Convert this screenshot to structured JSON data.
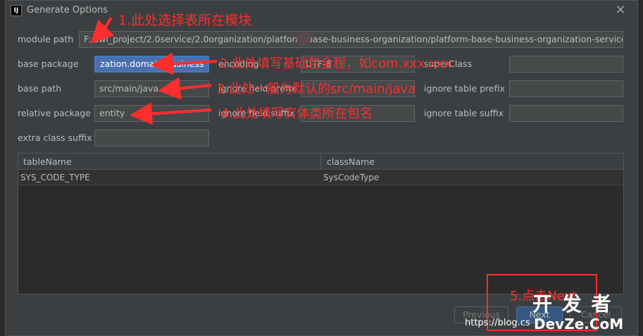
{
  "window": {
    "title": "Generate Options",
    "app_icon_text": "IJ"
  },
  "form": {
    "module_path": {
      "label": "module path",
      "value": "F:/swl_project/2.0service/2.0organization/platform-base-business-organization/platform-base-business-organization-service"
    },
    "base_package": {
      "label": "base package",
      "value": "zation.domain.business"
    },
    "encoding": {
      "label": "encoding",
      "value": "UTF-8"
    },
    "super_class": {
      "label": "superClass",
      "value": ""
    },
    "base_path": {
      "label": "base path",
      "value": "src/main/java"
    },
    "ignore_field_prefix": {
      "label": "ignore field prefix",
      "value": ""
    },
    "ignore_table_prefix": {
      "label": "ignore table prefix",
      "value": ""
    },
    "relative_package": {
      "label": "relative package",
      "value": "entity"
    },
    "ignore_field_suffix": {
      "label": "ignore field suffix",
      "value": ""
    },
    "ignore_table_suffix": {
      "label": "ignore table suffix",
      "value": ""
    },
    "extra_class_suffix": {
      "label": "extra class suffix",
      "value": ""
    }
  },
  "table": {
    "columns": [
      "tableName",
      "className"
    ],
    "rows": [
      [
        "SYS_CODE_TYPE",
        "SysCodeType"
      ]
    ]
  },
  "buttons": {
    "previous": "Previous",
    "next": "Next",
    "cancel": "Cancel"
  },
  "annotations": {
    "a1": "1.此处选择表所在模块",
    "a2": "2.此处填写基础包全程，如com.xxx.xxx",
    "a3": "3.此处一般为默认的src/main/java",
    "a4": "4.此处填写实体类所在包名",
    "a5": "5.点击Next"
  },
  "watermark": {
    "url": "https://blog.cs",
    "logo_top": "开 发 者",
    "logo_bottom": "DevZe.CoM"
  },
  "colors": {
    "annotation": "#ff2d2d",
    "background": "#3c3f41",
    "field": "#45494a"
  }
}
